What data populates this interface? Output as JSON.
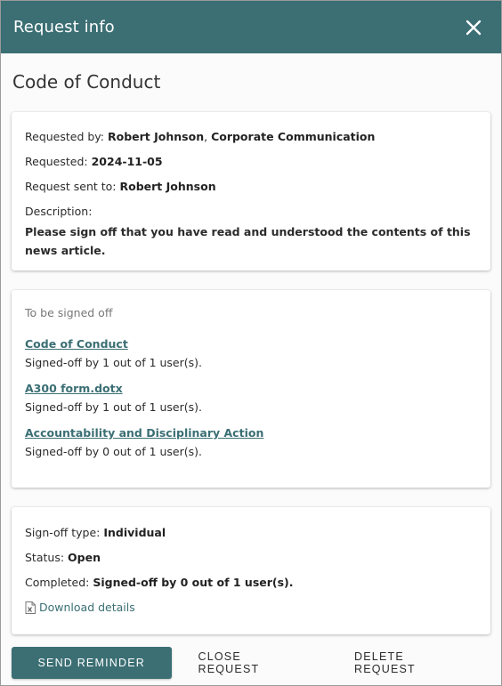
{
  "header": {
    "title": "Request info",
    "close_icon": "close-icon"
  },
  "page_title": "Code of Conduct",
  "request": {
    "requested_by_label": "Requested by:",
    "requested_by_name": "Robert Johnson",
    "requested_by_sep": ",",
    "requested_by_dept": "Corporate Communication",
    "requested_label": "Requested:",
    "requested_date": "2024-11-05",
    "sent_to_label": "Request sent to:",
    "sent_to_value": "Robert Johnson",
    "description_label": "Description:",
    "description": "Please sign off that you have read and understood the contents of this news article."
  },
  "signoff_list": {
    "heading": "To be signed off",
    "items": [
      {
        "title": "Code of Conduct",
        "status": "Signed-off by 1 out of 1 user(s)."
      },
      {
        "title": "A300 form.dotx",
        "status": "Signed-off by 1 out of 1 user(s)."
      },
      {
        "title": "Accountability and Disciplinary Action",
        "status": "Signed-off by 0 out of 1 user(s)."
      }
    ]
  },
  "summary": {
    "type_label": "Sign-off type:",
    "type_value": "Individual",
    "status_label": "Status:",
    "status_value": "Open",
    "completed_label": "Completed:",
    "completed_value": "Signed-off by 0 out of 1 user(s).",
    "download_label": "Download details",
    "download_icon": "excel-file-icon"
  },
  "actions": {
    "send_reminder": "SEND REMINDER",
    "close_request": "CLOSE REQUEST",
    "delete_request": "DELETE REQUEST"
  },
  "colors": {
    "accent": "#3b6f74"
  }
}
